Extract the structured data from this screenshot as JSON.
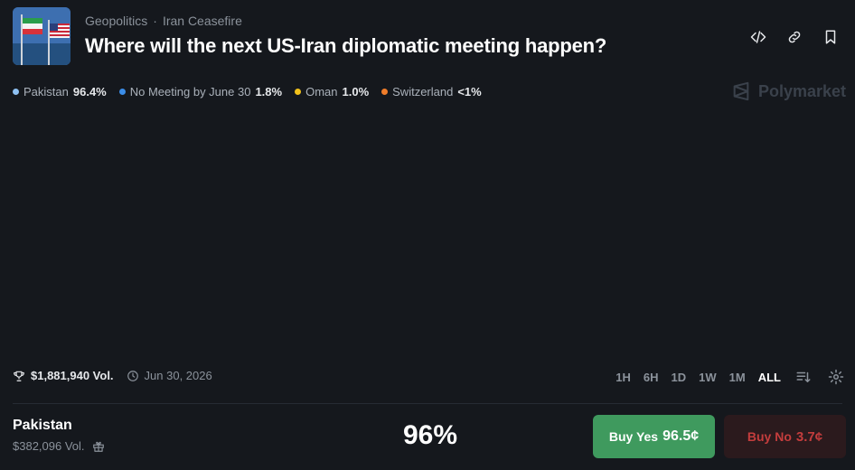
{
  "breadcrumb": {
    "category": "Geopolitics",
    "separator": "·",
    "subcategory": "Iran Ceasefire"
  },
  "title": "Where will the next US-Iran diplomatic meeting happen?",
  "legend": [
    {
      "label": "Pakistan",
      "value": "96.4%",
      "color": "#8fc1f2"
    },
    {
      "label": "No Meeting by June 30",
      "value": "1.8%",
      "color": "#3b8de8"
    },
    {
      "label": "Oman",
      "value": "1.0%",
      "color": "#f2c21b"
    },
    {
      "label": "Switzerland",
      "value": "<1%",
      "color": "#f07d2a"
    }
  ],
  "brand": "Polymarket",
  "meta": {
    "volume": "$1,881,940 Vol.",
    "end_date": "Jun 30, 2026"
  },
  "time_ranges": [
    "1H",
    "6H",
    "1D",
    "1W",
    "1M",
    "ALL"
  ],
  "selected_range": "ALL",
  "outcome": {
    "name": "Pakistan",
    "volume": "$382,096 Vol.",
    "probability": "96%",
    "buy_yes_label": "Buy Yes",
    "buy_yes_price": "96.5¢",
    "buy_no_label": "Buy No",
    "buy_no_price": "3.7¢"
  }
}
